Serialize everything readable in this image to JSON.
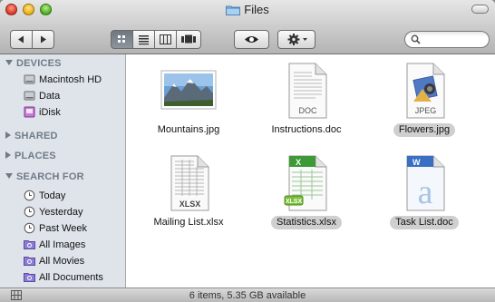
{
  "window": {
    "title": "Files"
  },
  "toolbar": {
    "back_icon": "back-arrow-icon",
    "forward_icon": "forward-arrow-icon",
    "view_modes": [
      "icon-view",
      "list-view",
      "column-view",
      "cover-flow-view"
    ],
    "quick_look_icon": "eye-icon",
    "action_icon": "gear-icon",
    "search": {
      "value": "",
      "placeholder": ""
    }
  },
  "sidebar": {
    "sections": {
      "devices": "DEVICES",
      "shared": "SHARED",
      "places": "PLACES",
      "search_for": "SEARCH FOR"
    },
    "devices": [
      {
        "label": "Macintosh HD",
        "icon": "hard-drive-icon"
      },
      {
        "label": "Data",
        "icon": "hard-drive-icon"
      },
      {
        "label": "iDisk",
        "icon": "idisk-icon"
      }
    ],
    "search_for": [
      {
        "label": "Today",
        "icon": "clock-icon"
      },
      {
        "label": "Yesterday",
        "icon": "clock-icon"
      },
      {
        "label": "Past Week",
        "icon": "clock-icon"
      },
      {
        "label": "All Images",
        "icon": "smart-folder-icon"
      },
      {
        "label": "All Movies",
        "icon": "smart-folder-icon"
      },
      {
        "label": "All Documents",
        "icon": "smart-folder-icon"
      }
    ]
  },
  "files": [
    {
      "name": "Mountains.jpg",
      "icon": "image-thumbnail-icon",
      "badge": "",
      "selected": false
    },
    {
      "name": "Instructions.doc",
      "icon": "document-icon",
      "badge": "DOC",
      "selected": false
    },
    {
      "name": "Flowers.jpg",
      "icon": "jpeg-preview-icon",
      "badge": "JPEG",
      "selected": true
    },
    {
      "name": "Mailing List.xlsx",
      "icon": "spreadsheet-icon",
      "badge": "XLSX",
      "selected": false
    },
    {
      "name": "Statistics.xlsx",
      "icon": "excel-icon",
      "badge": "XLSX",
      "selected": true
    },
    {
      "name": "Task List.doc",
      "icon": "word-icon",
      "badge": "",
      "selected": true
    }
  ],
  "status": {
    "text": "6 items, 5.35 GB available"
  },
  "colors": {
    "sidebar_bg": "#dfe4ea",
    "section_header": "#707b86",
    "selection": "#cfcfcf"
  }
}
